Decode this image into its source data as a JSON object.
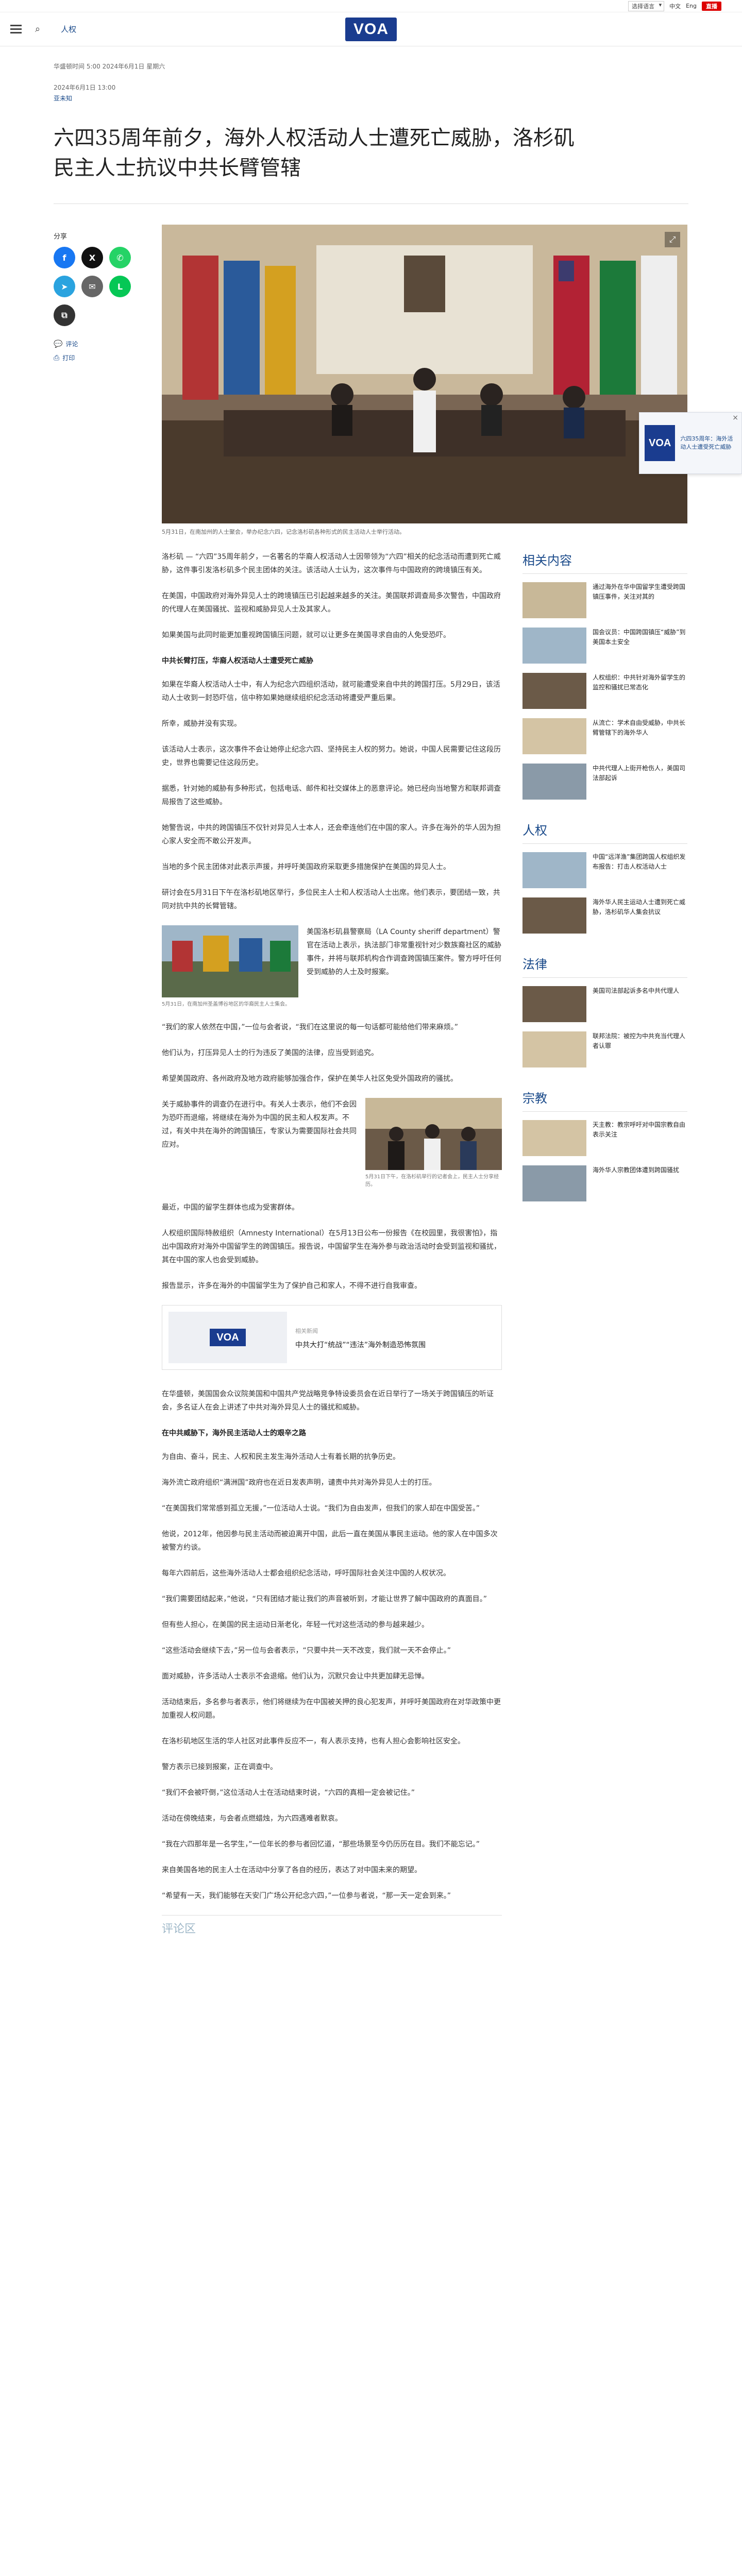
{
  "util": {
    "language": "选择语言",
    "links": [
      "中文",
      "Eng"
    ],
    "live": "直播"
  },
  "header": {
    "section": "人权",
    "logo": "VOA"
  },
  "article": {
    "published": "华盛顿时间 5:00 2024年6月1日 星期六",
    "updated": "2024年6月1日 13:00",
    "author": "亚未知",
    "headline": "六四35周年前夕，海外人权活动人士遭死亡威胁，洛杉矶民主人士抗议中共长臂管辖",
    "share_label": "分享",
    "share_buttons": [
      {
        "name": "facebook",
        "glyph": "f",
        "color": "#1877f2"
      },
      {
        "name": "twitter",
        "glyph": "X",
        "color": "#111111"
      },
      {
        "name": "whatsapp",
        "glyph": "✆",
        "color": "#25d366"
      },
      {
        "name": "telegram",
        "glyph": "➤",
        "color": "#2aa3df"
      },
      {
        "name": "email",
        "glyph": "✉",
        "color": "#666666"
      },
      {
        "name": "line",
        "glyph": "L",
        "color": "#06c755"
      },
      {
        "name": "copy-link",
        "glyph": "⧉",
        "color": "#333333"
      }
    ],
    "comment_link": "评论",
    "print_link": "打印",
    "hero_caption": "5月31日，在南加州的人士聚会，举办纪念六四，记念洛杉矶各种形式的民主活动人士举行活动。",
    "paragraphs": [
      "洛杉矶 — “六四”35周年前夕，一名著名的华裔人权活动人士因带领为“六四”相关的纪念活动而遭到死亡威胁，这件事引发洛杉矶多个民主团体的关注。该活动人士认为，这次事件与中国政府的跨境镇压有关。",
      "在美国，中国政府对海外异见人士的跨境镇压已引起越来越多的关注。美国联邦调查局多次警告，中国政府的代理人在美国骚扰、监视和威胁异见人士及其家人。",
      "如果美国与此同时能更加重视跨国镇压问题，就可以让更多在美国寻求自由的人免受恐吓。"
    ],
    "subhead1": "中共长臂打压，华裔人权活动人士遭受死亡威胁",
    "paragraphs2": [
      "如果在华裔人权活动人士中，有人为纪念六四组织活动，就可能遭受来自中共的跨国打压。5月29日，该活动人士收到一封恐吓信，信中称如果她继续组织纪念活动将遭受严重后果。",
      "所幸，威胁并没有实现。",
      "该活动人士表示，这次事件不会让她停止纪念六四、坚持民主人权的努力。她说，中国人民需要记住这段历史，世界也需要记住这段历史。",
      "据悉，针对她的威胁有多种形式，包括电话、邮件和社交媒体上的恶意评论。她已经向当地警方和联邦调查局报告了这些威胁。",
      "她警告说，中共的跨国镇压不仅针对异见人士本人，还会牵连他们在中国的家人。许多在海外的华人因为担心家人安全而不敢公开发声。",
      "当地的多个民主团体对此表示声援，并呼吁美国政府采取更多措施保护在美国的异见人士。",
      "研讨会在5月31日下午在洛杉矶地区举行，多位民主人士和人权活动人士出席。他们表示，要团结一致，共同对抗中共的长臂管辖。"
    ],
    "figure1_caption": "5月31日，在南加州圣盖博谷地区的华裔民主人士集会。",
    "figure1_text": "美国洛杉矶县警察局（LA County sheriff department）警官在活动上表示，执法部门非常重视针对少数族裔社区的威胁事件，并将与联邦机构合作调查跨国镇压案件。警方呼吁任何受到威胁的人士及时报案。",
    "paragraphs3": [
      "“我们的家人依然在中国，”一位与会者说，“我们在这里说的每一句话都可能给他们带来麻烦。”",
      "他们认为，打压异见人士的行为违反了美国的法律，应当受到追究。",
      "希望美国政府、各州政府及地方政府能够加强合作，保护在美华人社区免受外国政府的骚扰。"
    ],
    "figure2_caption": "5月31日下午，在洛杉矶举行的记者会上，民主人士分享经历。",
    "figure2_text": "关于威胁事件的调查仍在进行中。有关人士表示，他们不会因为恐吓而退缩，将继续在海外为中国的民主和人权发声。不过，有关中共在海外的跨国镇压，专家认为需要国际社会共同应对。",
    "paragraphs4": [
      "最近，中国的留学生群体也成为受害群体。",
      "人权组织国际特赦组织（Amnesty International）在5月13日公布一份报告《在校园里，我很害怕》，指出中国政府对海外中国留学生的跨国镇压。报告说，中国留学生在海外参与政治活动时会受到监视和骚扰，其在中国的家人也会受到威胁。",
      "报告显示，许多在海外的中国留学生为了保护自己和家人，不得不进行自我审查。"
    ],
    "related": {
      "label": "相关新闻",
      "title": "中共大打“统战”“违法”海外制造恐怖氛围"
    },
    "paragraphs5": [
      "在华盛顿，美国国会众议院美国和中国共产党战略竞争特设委员会在近日举行了一场关于跨国镇压的听证会，多名证人在会上讲述了中共对海外异见人士的骚扰和威胁。"
    ],
    "subhead2": "在中共威胁下，海外民主活动人士的艰辛之路",
    "paragraphs6": [
      "为自由、奋斗，民主、人权和民主发生海外活动人士有着长期的抗争历史。",
      "海外流亡政府组织“满洲国”政府也在近日发表声明，谴责中共对海外异见人士的打压。",
      "“在美国我们常常感到孤立无援，”一位活动人士说。“我们为自由发声，但我们的家人却在中国受苦。”",
      "他说，2012年，他因参与民主活动而被迫离开中国，此后一直在美国从事民主运动。他的家人在中国多次被警方约谈。",
      "每年六四前后，这些海外活动人士都会组织纪念活动，呼吁国际社会关注中国的人权状况。",
      "“我们需要团结起来，”他说，“只有团结才能让我们的声音被听到，才能让世界了解中国政府的真面目。”",
      "但有些人担心，在美国的民主运动日渐老化，年轻一代对这些活动的参与越来越少。",
      "“这些活动会继续下去，”另一位与会者表示，“只要中共一天不改变，我们就一天不会停止。”",
      "面对威胁，许多活动人士表示不会退缩。他们认为，沉默只会让中共更加肆无忌惮。",
      "活动结束后，多名参与者表示，他们将继续为在中国被关押的良心犯发声，并呼吁美国政府在对华政策中更加重视人权问题。",
      "在洛杉矶地区生活的华人社区对此事件反应不一，有人表示支持，也有人担心会影响社区安全。",
      "警方表示已接到报案，正在调查中。",
      "“我们不会被吓倒，”这位活动人士在活动结束时说，“六四的真相一定会被记住。”",
      "活动在傍晚结束，与会者点燃蜡烛，为六四遇难者默哀。",
      "“我在六四那年是一名学生，”一位年长的参与者回忆道，“那些场景至今仍历历在目。我们不能忘记。”",
      "来自美国各地的民主人士在活动中分享了各自的经历，表达了对中国未来的期望。",
      "“希望有一天，我们能够在天安门广场公开纪念六四，”一位参与者说，“那一天一定会到来。”"
    ],
    "comments_title": "评论区"
  },
  "sidebar": {
    "sections": [
      {
        "title": "相关内容",
        "items": [
          "通过海外在华中国留学生遭受跨国镇压事件，关注对其的",
          "国会议员：中国跨国镇压“威胁”到美国本土安全",
          "人权组织：中共针对海外留学生的监控和骚扰已常态化",
          "从流亡：学术自由受威胁，中共长臂管辖下的海外华人",
          "中共代理人上街开枪伤人，美国司法部起诉"
        ]
      },
      {
        "title": "人权",
        "items": [
          "中国“远洋渔”集团跨国人权组织发布报告：打击人权活动人士",
          "海外华人民主运动人士遭到死亡威胁，洛杉矶华人集会抗议"
        ]
      },
      {
        "title": "法律",
        "items": [
          "美国司法部起诉多名中共代理人",
          "联邦法院：被控为中共充当代理人者认罪"
        ]
      },
      {
        "title": "宗教",
        "items": [
          "天主教：教宗呼吁对中国宗教自由表示关注",
          "海外华人宗教团体遭到跨国骚扰"
        ]
      }
    ]
  },
  "float_widget": {
    "logo": "VOA",
    "text": "六四35周年：海外活动人士遭受死亡威胁"
  },
  "colors": {
    "brand": "#1a3c8f",
    "link": "#1a4a8a",
    "live": "#dd0000"
  }
}
